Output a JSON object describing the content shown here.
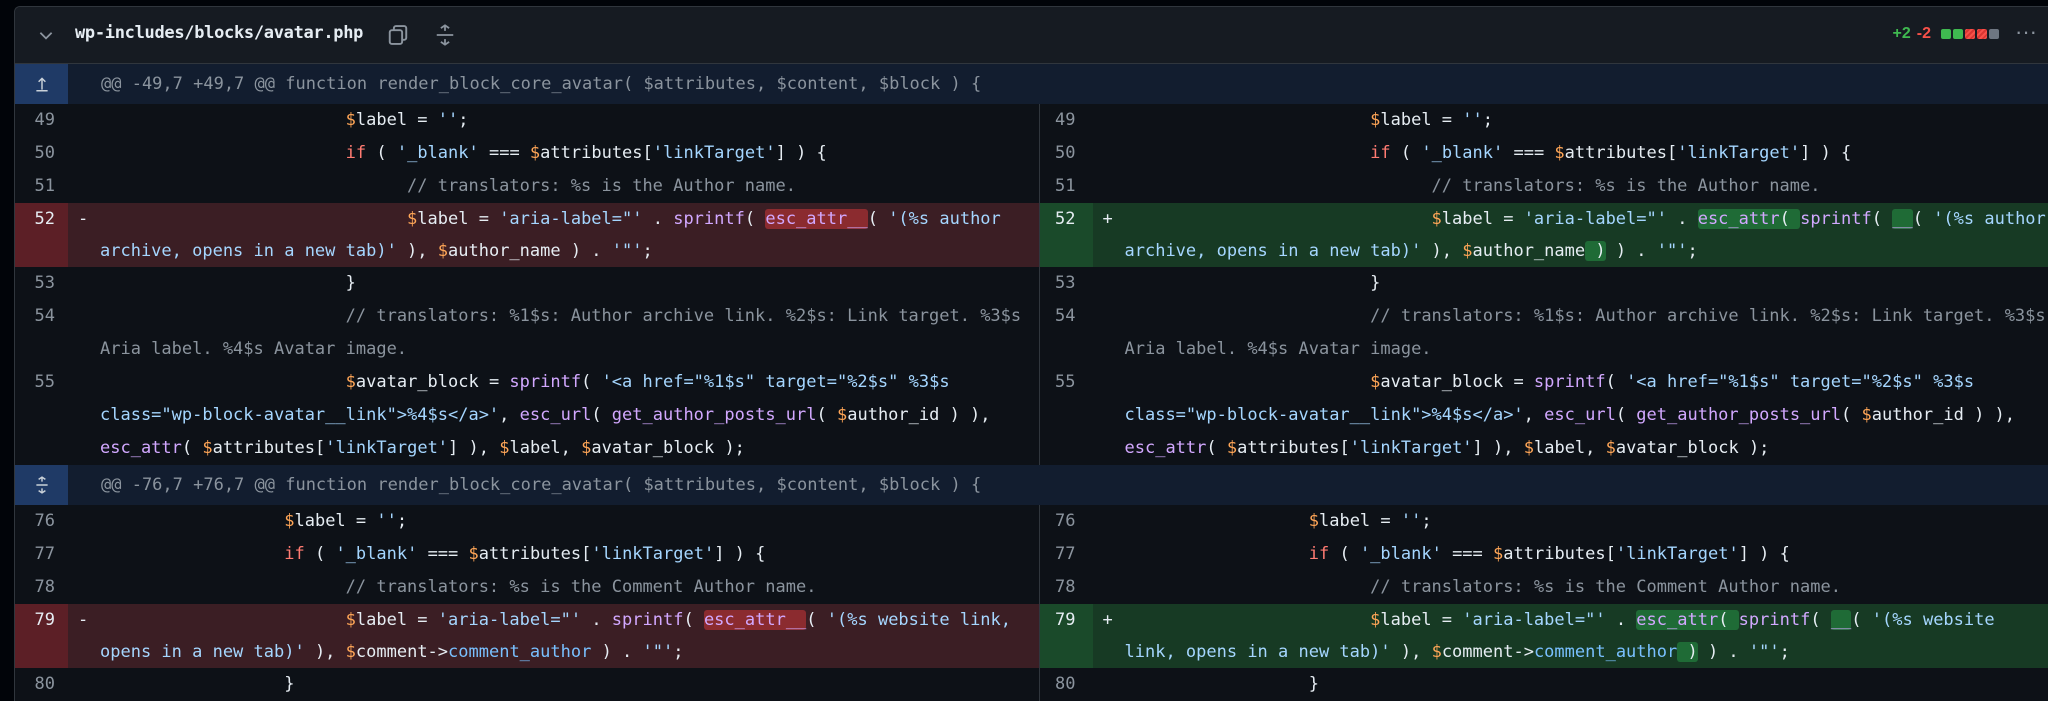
{
  "file": {
    "path": "wp-includes/blocks/avatar.php",
    "additions": "+2",
    "deletions": "-2",
    "diff_boxes": [
      "#3fb950",
      "#3fb950",
      "#f85149",
      "#f85149",
      "#6e7681"
    ],
    "icons": [
      "chevron-down-icon",
      "copy-icon",
      "expand-all-icon",
      "kebab-menu-icon"
    ]
  },
  "hunks": [
    {
      "header": "@@ -49,7 +49,7 @@ function render_block_core_avatar( $attributes, $content, $block ) {"
    },
    {
      "header": "@@ -76,7 +76,7 @@ function render_block_core_avatar( $attributes, $content, $block ) {"
    }
  ],
  "lines": {
    "l49": "49",
    "l50": "50",
    "l51": "51",
    "l52": "52",
    "l53": "53",
    "l54": "54",
    "l55": "55",
    "l76": "76",
    "l77": "77",
    "l78": "78",
    "l79": "79",
    "l80": "80",
    "minus": "-",
    "plus": "+"
  },
  "colors": {
    "added": "#3fb950",
    "deleted": "#f85149",
    "hunk_bg": "#121d2f"
  }
}
